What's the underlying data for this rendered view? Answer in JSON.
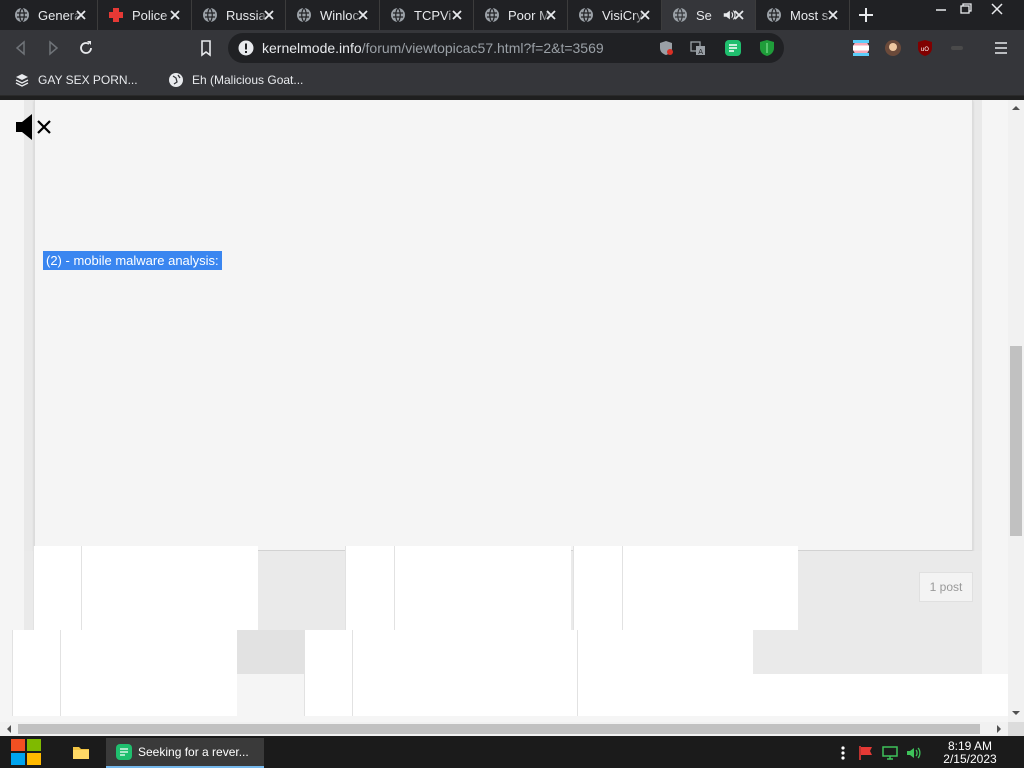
{
  "tabs": [
    {
      "title": "Genera",
      "active": false
    },
    {
      "title": "Police",
      "active": false
    },
    {
      "title": "Russia",
      "active": false
    },
    {
      "title": "Winloc",
      "active": false
    },
    {
      "title": "TCPVi",
      "active": false
    },
    {
      "title": "Poor M",
      "active": false
    },
    {
      "title": "VisiCry",
      "active": false
    },
    {
      "title": "Se",
      "active": true
    },
    {
      "title": "Most s",
      "active": false
    }
  ],
  "address": {
    "host": "kernelmode.info",
    "path": "/forum/viewtopicac57.html?f=2&t=3569"
  },
  "bookmarks": [
    {
      "label": "GAY SEX PORN..."
    },
    {
      "label": "Eh (Malicious Goat..."
    }
  ],
  "page": {
    "selected_text": "(2) - mobile malware analysis:",
    "post_count": "1 post"
  },
  "taskbar": {
    "chrome_window_title": "Seeking for a rever...",
    "time": "8:19 AM",
    "date": "2/15/2023"
  },
  "colors": {
    "selection": "#3a86f0",
    "tab_bar": "#202124",
    "toolbar": "#35363a"
  }
}
